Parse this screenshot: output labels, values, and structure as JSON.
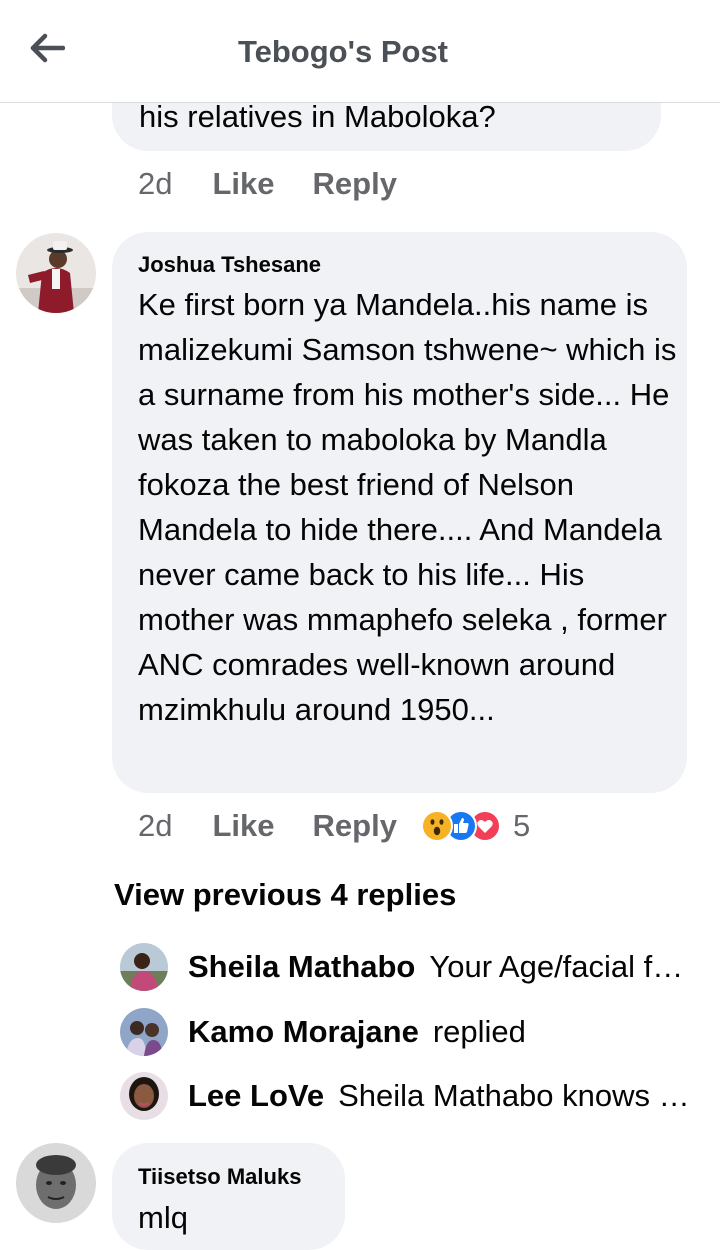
{
  "header": {
    "title": "Tebogo's Post",
    "back_icon": "arrow-left-icon"
  },
  "previous_comment": {
    "text_tail": "his relatives in Maboloka?",
    "time": "2d",
    "like_label": "Like",
    "reply_label": "Reply"
  },
  "main_comment": {
    "author": "Joshua Tshesane",
    "text": "Ke first born ya Mandela..his name is malizekumi Samson tshwene~ which is a surname from his mother's side... He was taken to maboloka by Mandla fokoza the best friend of Nelson Mandela to hide there.... And Mandela never came back to his life... His mother was mmaphefo seleka , former ANC comrades well-known around mzimkhulu around 1950...",
    "time": "2d",
    "like_label": "Like",
    "reply_label": "Reply",
    "reaction_count": "5",
    "reactions": [
      "wow-icon",
      "like-icon",
      "love-icon"
    ]
  },
  "view_previous": "View previous 4 replies",
  "replies": [
    {
      "name": "Sheila Mathabo",
      "text": "Your Age/facial features.."
    },
    {
      "name": "Kamo Morajane",
      "text": "replied"
    },
    {
      "name": "Lee LoVe",
      "text": "Sheila Mathabo knows more.."
    }
  ],
  "last_comment": {
    "author": "Tiisetso Maluks",
    "text": "mlq"
  },
  "colors": {
    "bubble": "#f0f2f5",
    "meta": "#65676b",
    "like_blue": "#1877f2",
    "love_red": "#f33e58",
    "wow_yellow": "#f7b125"
  }
}
